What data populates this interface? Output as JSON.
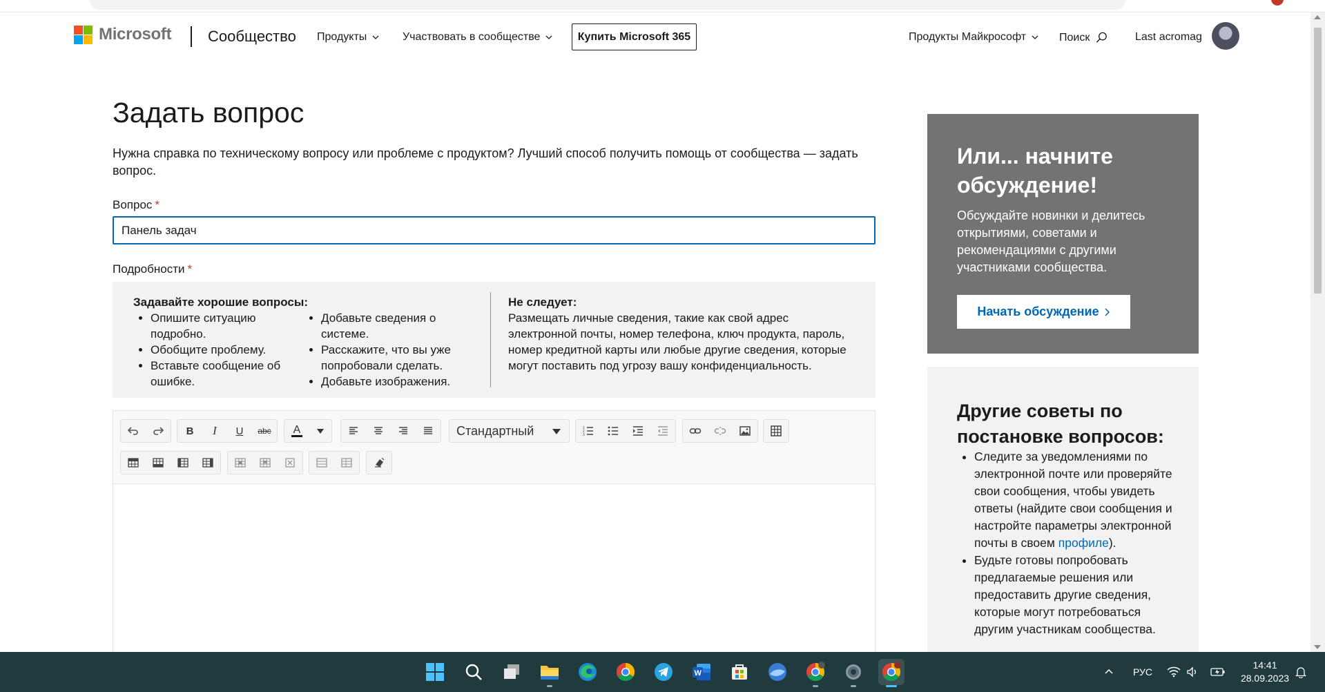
{
  "header": {
    "logo_text": "Microsoft",
    "community_title": "Сообщество",
    "nav": {
      "products": "Продукты",
      "participate": "Участвовать в сообществе",
      "buy": "Купить Microsoft 365",
      "ms_products": "Продукты Майкрософт",
      "search": "Поиск",
      "user": "Last acromag"
    }
  },
  "form": {
    "title": "Задать вопрос",
    "intro": "Нужна справка по техническому вопросу или проблеме с продуктом? Лучший способ получить помощь от сообщества — задать вопрос.",
    "question_label": "Вопрос",
    "question_value": "Панель задач",
    "details_label": "Подробности",
    "required_mark": "*",
    "tips": {
      "do_title": "Задавайте хорошие вопросы:",
      "do_col1": [
        "Опишите ситуацию подробно.",
        "Обобщите проблему.",
        "Вставьте сообщение об ошибке."
      ],
      "do_col2": [
        "Добавьте сведения о системе.",
        "Расскажите, что вы уже попробовали сделать.",
        "Добавьте изображения."
      ],
      "dont_title": "Не следует:",
      "dont_text": "Размещать личные сведения, такие как свой адрес электронной почты, номер телефона, ключ продукта, пароль, номер кредитной карты или любые другие сведения, которые могут поставить под угрозу вашу конфиденциальность."
    },
    "editor": {
      "style_select": "Стандартный"
    }
  },
  "sidebar": {
    "discuss_title": "Или... начните обсуждение!",
    "discuss_text": "Обсуждайте новинки и делитесь открытиями, советами и рекомендациями с другими участниками сообщества.",
    "discuss_button": "Начать обсуждение",
    "tips_title": "Другие советы по постановке вопросов:",
    "tip1_before": "Следите за уведомлениями по электронной почте или проверяйте свои сообщения, чтобы увидеть ответы (найдите свои сообщения и настройте параметры электронной почты в своем ",
    "tip1_link": "профиле",
    "tip1_after": ").",
    "tip2": "Будьте готовы попробовать предлагаемые решения или предоставить другие сведения, которые могут потребоваться другим участникам сообщества."
  },
  "taskbar": {
    "language": "РУС",
    "time": "14:41",
    "date": "28.09.2023"
  },
  "colors": {
    "accent": "#0067b8",
    "ms_red": "#f25022",
    "ms_green": "#7fba00",
    "ms_blue": "#00a4ef",
    "ms_yellow": "#ffb900",
    "discuss_bg": "#737373",
    "taskbar_bg": "#1f3b3d"
  }
}
